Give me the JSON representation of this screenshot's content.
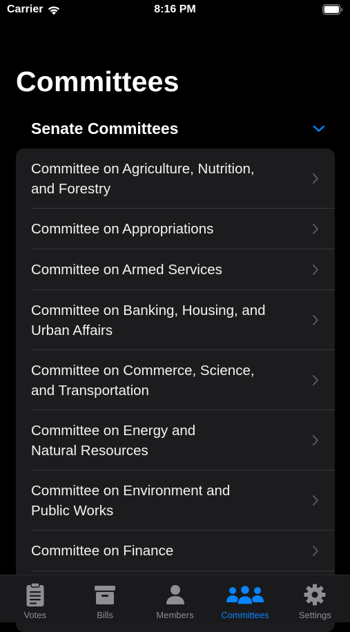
{
  "status_bar": {
    "carrier": "Carrier",
    "time": "8:16 PM"
  },
  "page": {
    "title": "Committees"
  },
  "section": {
    "title": "Senate Committees",
    "expanded": true,
    "accent_color": "#0a84ff"
  },
  "committees": [
    {
      "label": "Committee on Agriculture, Nutrition,\nand Forestry"
    },
    {
      "label": "Committee on Appropriations"
    },
    {
      "label": "Committee on Armed Services"
    },
    {
      "label": "Committee on Banking, Housing, and\nUrban Affairs"
    },
    {
      "label": "Committee on Commerce, Science,\nand Transportation"
    },
    {
      "label": "Committee on Energy and\nNatural Resources"
    },
    {
      "label": "Committee on Environment and\nPublic Works"
    },
    {
      "label": "Committee on Finance"
    }
  ],
  "tab_bar": {
    "active_tab": "Committees",
    "tabs": [
      {
        "label": "Votes",
        "icon": "clipboard-icon"
      },
      {
        "label": "Bills",
        "icon": "archive-box-icon"
      },
      {
        "label": "Members",
        "icon": "person-icon"
      },
      {
        "label": "Committees",
        "icon": "people-group-icon"
      },
      {
        "label": "Settings",
        "icon": "gear-icon"
      }
    ]
  }
}
